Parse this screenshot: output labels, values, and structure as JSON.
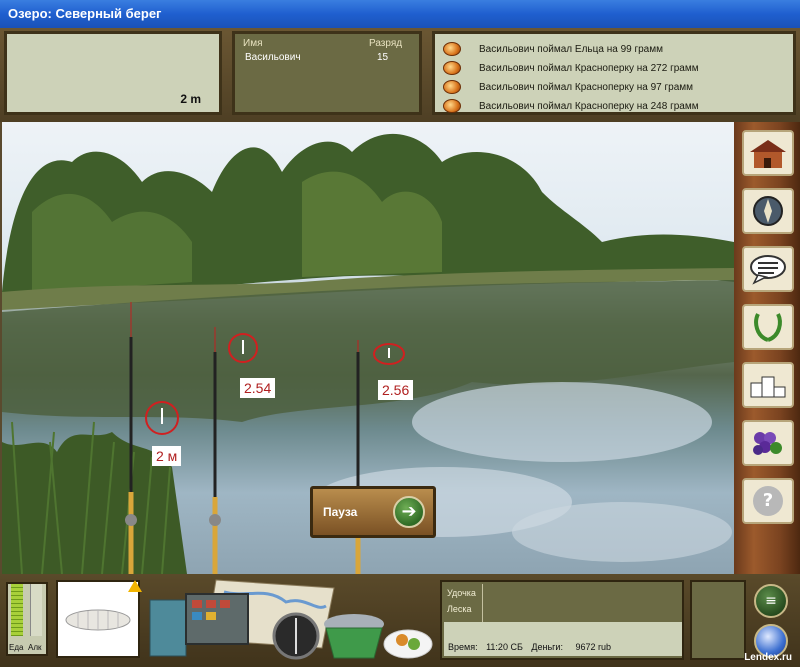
{
  "window": {
    "title": "Озеро: Северный берег"
  },
  "depth_panel": {
    "value": "2 m"
  },
  "player_panel": {
    "name_header": "Имя",
    "rank_header": "Разряд",
    "name": "Васильович",
    "rank": "15"
  },
  "catch_log": [
    "Васильович поймал Ельца на 99 грамм",
    "Васильович поймал Красноперку на 272 грамм",
    "Васильович поймал Красноперку на 97 грамм",
    "Васильович поймал Красноперку на 248 грамм"
  ],
  "rods": [
    {
      "label": "2 м"
    },
    {
      "label": "2.54"
    },
    {
      "label": "2.56"
    }
  ],
  "pause_button": {
    "label": "Пауза",
    "arrow": "➔"
  },
  "sidebar": {
    "buttons": [
      {
        "name": "home-icon"
      },
      {
        "name": "compass-icon"
      },
      {
        "name": "chat-icon"
      },
      {
        "name": "laurel-icon"
      },
      {
        "name": "podium-icon"
      },
      {
        "name": "grapes-icon"
      },
      {
        "name": "help-icon",
        "glyph": "?"
      }
    ]
  },
  "meters": {
    "food_label": "Еда",
    "alc_label": "Алк"
  },
  "info_panel": {
    "rod_label": "Удочка",
    "line_label": "Леска",
    "time_label": "Время:",
    "time_value": "11:20 СБ",
    "money_label": "Деньги:",
    "money_value": "9672 rub"
  },
  "menu_button": {
    "glyph": "≡"
  },
  "watermark": "Lendex.ru",
  "colors": {
    "bobber_circle": "#d02020",
    "panel_light": "#cdd2b8",
    "panel_dark": "#6b6a44"
  }
}
